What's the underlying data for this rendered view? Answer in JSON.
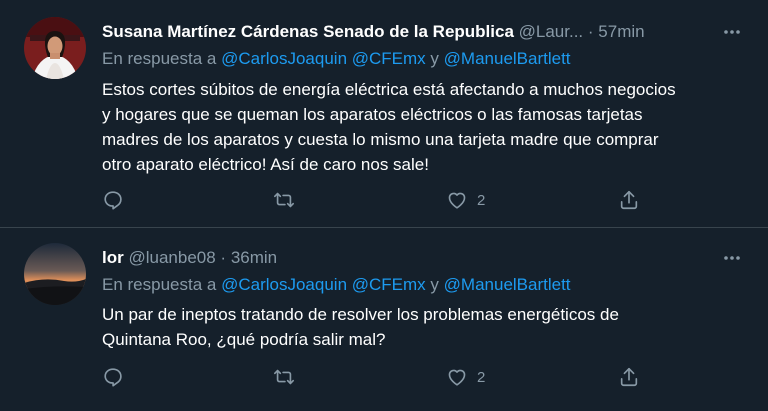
{
  "tweets": [
    {
      "name": "Susana Martínez Cárdenas Senado de la Republica",
      "handle": "@Laur...",
      "separator": "·",
      "time": "57min",
      "reply_prefix": "En respuesta a",
      "mentions": [
        "@CarlosJoaquin",
        "@CFEmx"
      ],
      "reply_and": "y",
      "last_mention": "@ManuelBartlett",
      "text_lines": [
        "Estos cortes súbitos de energía eléctrica está afectando a muchos negocios",
        "y hogares que se queman los aparatos eléctricos o las famosas tarjetas",
        "madres de los aparatos y cuesta lo mismo una tarjeta madre que comprar",
        "otro aparato eléctrico! Así de caro nos sale!"
      ],
      "like_count": "2",
      "more_icon": "more-horizontal-icon"
    },
    {
      "name": "lor",
      "handle": "@luanbe08",
      "separator": "·",
      "time": "36min",
      "reply_prefix": "En respuesta a",
      "mentions": [
        "@CarlosJoaquin",
        "@CFEmx"
      ],
      "reply_and": "y",
      "last_mention": "@ManuelBartlett",
      "text_lines": [
        "Un par de ineptos tratando de resolver los problemas energéticos de",
        "Quintana Roo, ¿qué podría salir mal?"
      ],
      "like_count": "2",
      "more_icon": "more-horizontal-icon"
    }
  ],
  "colors": {
    "background": "#15202b",
    "divider": "#38444d",
    "secondary_text": "#8899a6",
    "accent": "#1d9bf0",
    "primary_text": "#ffffff"
  },
  "icons": [
    "reply-icon",
    "retweet-icon",
    "like-icon",
    "share-icon"
  ]
}
